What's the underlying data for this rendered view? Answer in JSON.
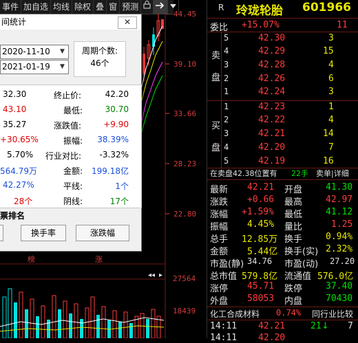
{
  "toolbar": {
    "items": [
      "事件",
      "加自选",
      "均线",
      "除权",
      "叠",
      "窗",
      "预测",
      "🔒",
      "→",
      "▼"
    ]
  },
  "chart": {
    "price_labels": [
      "44.45",
      "39.10",
      "33.66",
      "28.23",
      "22.80"
    ],
    "volume_labels": [
      "27564",
      "18439"
    ],
    "bottom_marks": [
      "榜",
      "涨"
    ],
    "colors": {
      "up": "#ff3c3c",
      "down": "#00e0e0",
      "axis": "#d23c3c",
      "ma1": "#ffffff",
      "ma2": "#e8e800",
      "ma3": "#ff40ff"
    }
  },
  "dialog": {
    "title": "间统计",
    "close": "✕",
    "start_date": "2020-11-10",
    "end_date": "2021-01-19",
    "period_label": "周期个数:",
    "period_value": "46个",
    "rows": [
      {
        "lv": "32.30",
        "rl": "终止价:",
        "rv": "42.20"
      },
      {
        "lv": "43.10",
        "rl": "最低:",
        "rv": "30.70"
      },
      {
        "lv": "35.27",
        "rl": "涨跌值:",
        "rv": "+9.90"
      },
      {
        "lv": "+30.65%",
        "rl": "振幅:",
        "rv": "38.39%"
      },
      {
        "lv": "5.70%",
        "rl": "行业对比:",
        "rv": "-3.32%"
      },
      {
        "lv": "564.79万",
        "rl": "金额:",
        "rv": "199.18亿"
      },
      {
        "lv": "42.27%",
        "rl": "平线:",
        "rv": "1个"
      },
      {
        "lv": "28个",
        "rl": "阴线:",
        "rv": "17个"
      }
    ],
    "ranking_title": "票排名",
    "buttons": [
      "换手率",
      "涨跌幅"
    ]
  },
  "quote": {
    "letter": "R",
    "name": "玲珑轮胎",
    "code": "601966",
    "weibi_label": "委比",
    "weibi_value": "+15.07%",
    "weibi_count": "11",
    "sell_label": [
      "卖",
      "盘"
    ],
    "buy_label": [
      "买",
      "盘"
    ],
    "sells": [
      {
        "n": "5",
        "p": "42.30",
        "v": "3"
      },
      {
        "n": "4",
        "p": "42.29",
        "v": "15"
      },
      {
        "n": "3",
        "p": "42.28",
        "v": "4"
      },
      {
        "n": "2",
        "p": "42.26",
        "v": "6"
      },
      {
        "n": "1",
        "p": "42.24",
        "v": "3"
      }
    ],
    "buys": [
      {
        "n": "1",
        "p": "42.23",
        "v": "1"
      },
      {
        "n": "2",
        "p": "42.22",
        "v": "4"
      },
      {
        "n": "3",
        "p": "42.21",
        "v": "14"
      },
      {
        "n": "4",
        "p": "42.20",
        "v": "7"
      },
      {
        "n": "5",
        "p": "42.19",
        "v": "16"
      }
    ],
    "sellpos": {
      "text": "在卖盘42.38位置有",
      "qty": "22手",
      "link": "卖单|详细"
    },
    "stats": [
      {
        "l": "最新",
        "v": "42.21",
        "vc": "cred",
        "l2": "开盘",
        "v2": "41.30",
        "v2c": "cgreen"
      },
      {
        "l": "涨跌",
        "v": "+0.66",
        "vc": "cred",
        "l2": "最高",
        "v2": "42.97",
        "v2c": "cred"
      },
      {
        "l": "涨幅",
        "v": "+1.59%",
        "vc": "cred",
        "l2": "最低",
        "v2": "41.12",
        "v2c": "cgreen"
      },
      {
        "l": "振幅",
        "v": "4.45%",
        "vc": "cyel",
        "l2": "量比",
        "v2": "1.25",
        "v2c": "cred"
      },
      {
        "l": "总手",
        "v": "12.85万",
        "vc": "cyel",
        "l2": "换手",
        "v2": "0.94%",
        "v2c": "cyel"
      },
      {
        "l": "金额",
        "v": "5.44亿",
        "vc": "cyel",
        "l2": "换手(实)",
        "v2": "2.32%",
        "v2c": "cyel"
      },
      {
        "l": "市盈(静)",
        "v": "34.76",
        "vc": "cwhite",
        "l2": "市盈(动)",
        "v2": "27.20",
        "v2c": "cwhite"
      },
      {
        "l": "总市值",
        "v": "579.8亿",
        "vc": "cyel",
        "l2": "流通值",
        "v2": "576.0亿",
        "v2c": "cyel"
      },
      {
        "l": "涨停",
        "v": "45.71",
        "vc": "cred",
        "l2": "跌停",
        "v2": "37.40",
        "v2c": "cgreen"
      },
      {
        "l": "外盘",
        "v": "58053",
        "vc": "cred",
        "l2": "内盘",
        "v2": "70430",
        "v2c": "cgreen"
      }
    ],
    "industry": {
      "name": "化工合成材料",
      "pct": "0.74%",
      "link": "同行业比较"
    },
    "ticks": [
      {
        "t": "14:11",
        "p": "42.21",
        "v": "21",
        "arrow": "↓",
        "n": "7"
      },
      {
        "t": "14:11",
        "p": "42.20",
        "v": "",
        "arrow": "",
        "n": ""
      }
    ]
  }
}
